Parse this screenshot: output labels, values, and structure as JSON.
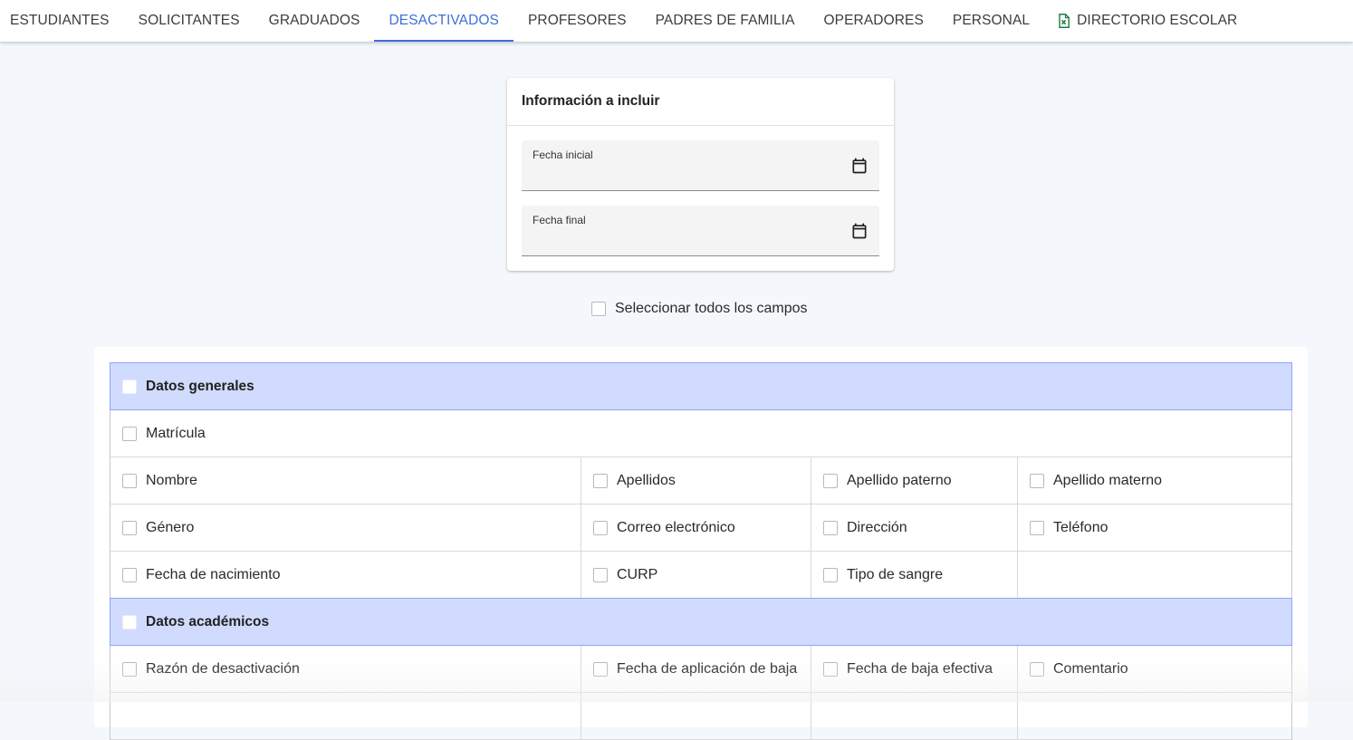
{
  "tabs": [
    {
      "label": "ESTUDIANTES"
    },
    {
      "label": "SOLICITANTES"
    },
    {
      "label": "GRADUADOS"
    },
    {
      "label": "DESACTIVADOS",
      "active": true
    },
    {
      "label": "PROFESORES"
    },
    {
      "label": "PADRES DE FAMILIA"
    },
    {
      "label": "OPERADORES"
    },
    {
      "label": "PERSONAL"
    },
    {
      "label": "DIRECTORIO ESCOLAR",
      "icon": "excel-file-icon"
    }
  ],
  "info_card": {
    "title": "Información a incluir",
    "start_date_label": "Fecha inicial",
    "end_date_label": "Fecha final"
  },
  "select_all_label": "Seleccionar todos los campos",
  "sections": {
    "general": {
      "title": "Datos generales",
      "matricula": "Matrícula",
      "nombre": "Nombre",
      "apellidos": "Apellidos",
      "apellido_paterno": "Apellido paterno",
      "apellido_materno": "Apellido materno",
      "genero": "Género",
      "correo": "Correo electrónico",
      "direccion": "Dirección",
      "telefono": "Teléfono",
      "fecha_nacimiento": "Fecha de nacimiento",
      "curp": "CURP",
      "tipo_sangre": "Tipo de sangre"
    },
    "academic": {
      "title": "Datos académicos",
      "razon": "Razón de desactivación",
      "fecha_aplicacion": "Fecha de aplicación de baja",
      "fecha_efectiva": "Fecha de baja efectiva",
      "comentario": "Comentario"
    }
  },
  "colors": {
    "accent": "#3f6fdc",
    "section_header": "#d0dbfd",
    "excel_icon": "#1e7d45"
  }
}
